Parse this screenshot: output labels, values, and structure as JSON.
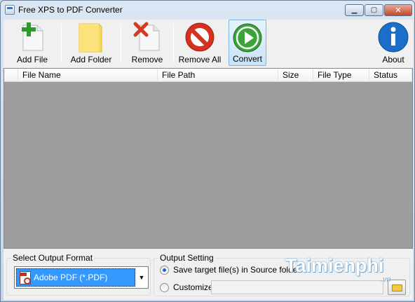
{
  "window": {
    "title": "Free XPS to PDF Converter",
    "controls": [
      "minimize",
      "maximize",
      "close"
    ]
  },
  "toolbar": {
    "add_file": "Add File",
    "add_folder": "Add Folder",
    "remove": "Remove",
    "remove_all": "Remove All",
    "convert": "Convert",
    "about": "About"
  },
  "file_list": {
    "columns": [
      "File Name",
      "File Path",
      "Size",
      "File Type",
      "Status"
    ],
    "rows": []
  },
  "output_format": {
    "title": "Select Output Format",
    "selected": "Adobe PDF (*.PDF)"
  },
  "output_setting": {
    "title": "Output Setting",
    "option_source": "Save target file(s) in Source folder",
    "option_customize": "Customize",
    "selected": "source",
    "custom_path": ""
  },
  "watermark": {
    "text": "Taimienphi",
    "sub": ".vn"
  },
  "colors": {
    "selection": "#3399ff",
    "list_background": "#9d9d9d",
    "convert_green": "#3aa33a",
    "remove_all_red": "#d4311f",
    "about_blue": "#1c6fc9"
  }
}
